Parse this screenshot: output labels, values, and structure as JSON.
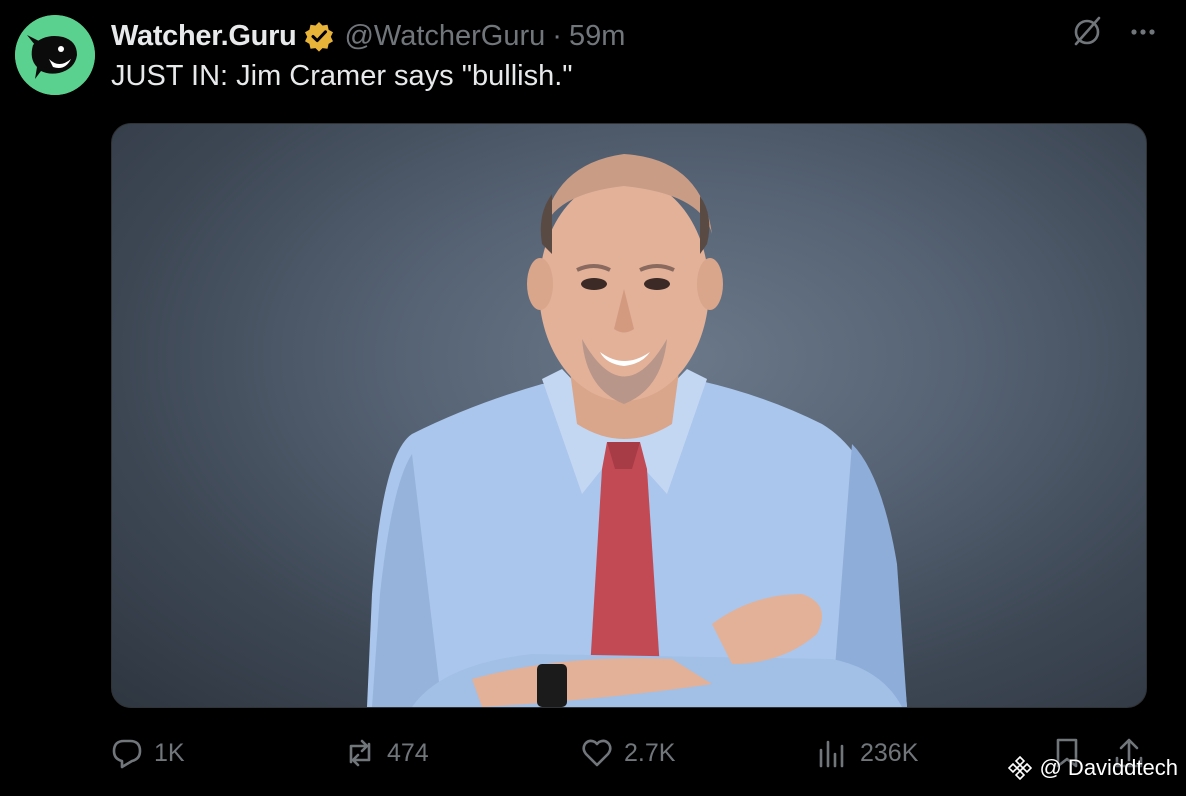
{
  "author": {
    "display_name": "Watcher.Guru",
    "handle": "@WatcherGuru",
    "separator": "·",
    "time_ago": "59m",
    "verified_badge": "gold-checkmark-icon",
    "avatar_color": "#5bd18f"
  },
  "tweet": {
    "text": "JUST IN: Jim Cramer says \"bullish.\""
  },
  "media": {
    "subject": "photo-man-blue-shirt-red-tie-arms-crossed"
  },
  "top_icons": [
    "grok-icon",
    "more-icon"
  ],
  "actions": {
    "reply": {
      "icon": "reply-icon",
      "count": "1K"
    },
    "repost": {
      "icon": "repost-icon",
      "count": "474"
    },
    "like": {
      "icon": "like-icon",
      "count": "2.7K"
    },
    "views": {
      "icon": "views-icon",
      "count": "236K"
    },
    "bookmark": {
      "icon": "bookmark-icon"
    },
    "share": {
      "icon": "share-icon"
    }
  },
  "watermark": {
    "text": "@ Daviddtech",
    "icon": "binance-icon"
  },
  "colors": {
    "background": "#000000",
    "primary_text": "#e7e9ea",
    "secondary_text": "#71767b",
    "verified_gold": "#e8b339"
  }
}
